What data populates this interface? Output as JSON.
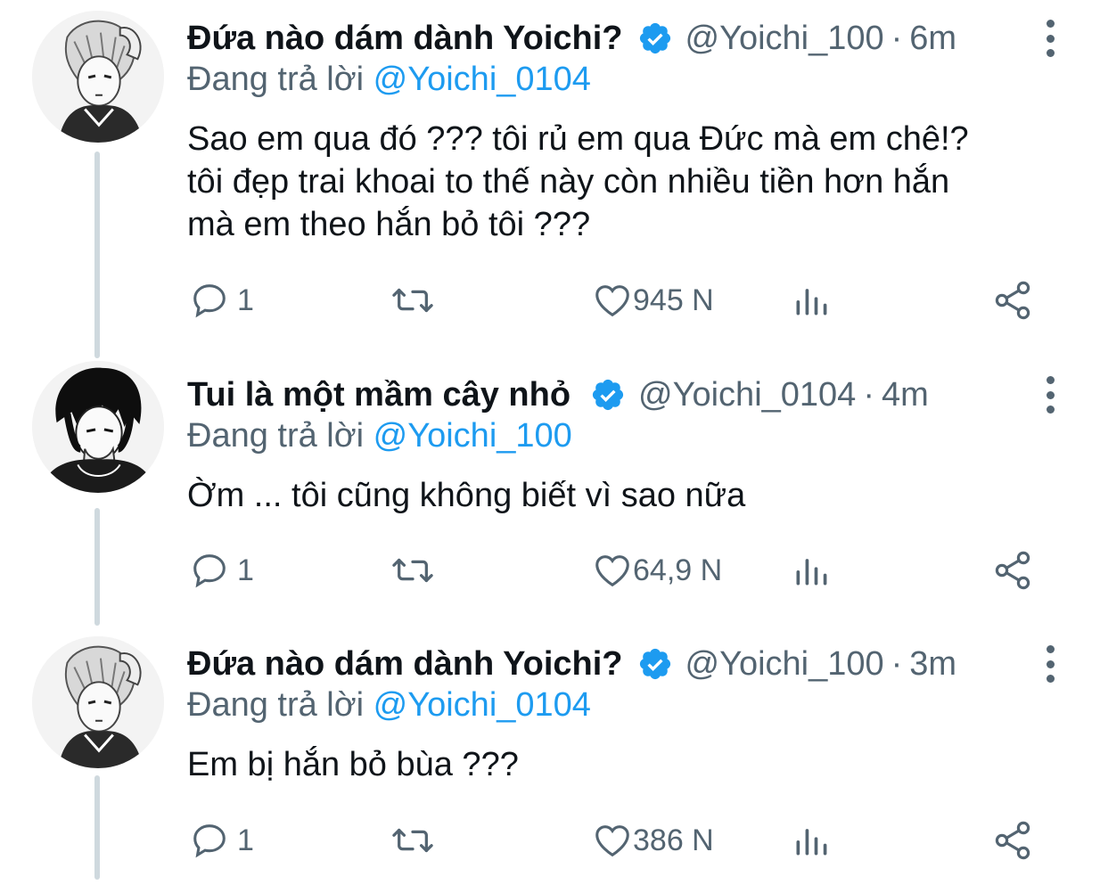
{
  "thread": {
    "tweets": [
      {
        "display_name": "Đứa nào dám dành Yoichi?",
        "handle": "@Yoichi_100",
        "separator": "·",
        "time": "6m",
        "replying_prefix": "Đang trả lời",
        "replying_to": "@Yoichi_0104",
        "text": "Sao em qua đó ??? tôi rủ em qua Đức mà em chê!?\ntôi đẹp trai khoai to thế này còn nhiều tiền hơn hắn\nmà em theo hắn bỏ tôi ???",
        "reply_count": "1",
        "like_count": "945 N",
        "avatar_icon": "manga-boy-light-hair-avatar"
      },
      {
        "display_name": "Tui là một mầm cây nhỏ",
        "handle": "@Yoichi_0104",
        "separator": "·",
        "time": "4m",
        "replying_prefix": "Đang trả lời",
        "replying_to": "@Yoichi_100",
        "text": "Ờm ... tôi cũng không biết vì sao nữa",
        "reply_count": "1",
        "like_count": "64,9 N",
        "avatar_icon": "manga-boy-dark-hair-avatar"
      },
      {
        "display_name": "Đứa nào dám dành Yoichi?",
        "handle": "@Yoichi_100",
        "separator": "·",
        "time": "3m",
        "replying_prefix": "Đang trả lời",
        "replying_to": "@Yoichi_0104",
        "text": "Em bị hắn bỏ bùa ???",
        "reply_count": "1",
        "like_count": "386 N",
        "avatar_icon": "manga-boy-light-hair-avatar"
      }
    ]
  },
  "icons": {
    "verified": "verified-badge-icon",
    "reply": "reply-icon",
    "retweet": "retweet-icon",
    "like": "heart-icon",
    "views": "analytics-icon",
    "share": "share-icon",
    "more": "more-vertical-icon"
  },
  "colors": {
    "text": "#0f1419",
    "secondary": "#536471",
    "accent": "#1d9bf0",
    "thread_line": "#cfd9de"
  }
}
